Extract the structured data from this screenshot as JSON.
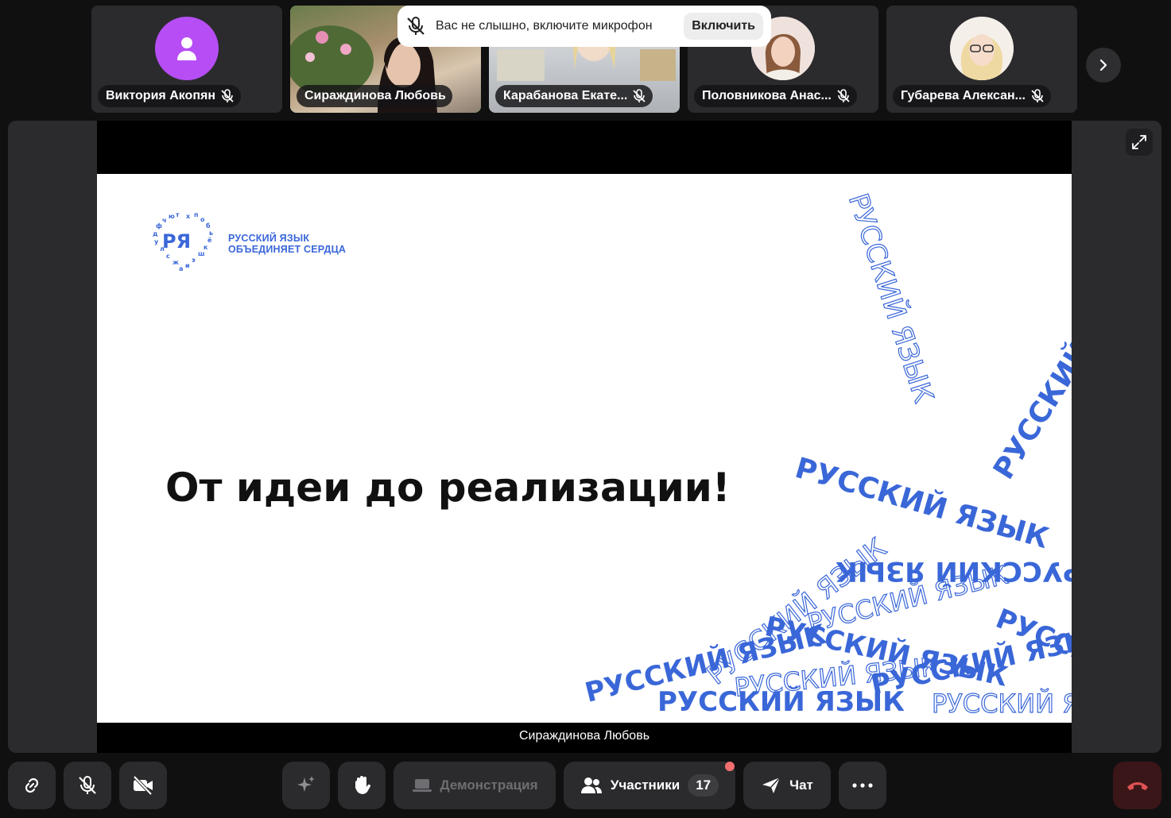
{
  "participants": [
    {
      "name": "Виктория Акопян",
      "muted": true,
      "avatar_color": "#b74ef5",
      "icon": "user-icon"
    },
    {
      "name": "Сираждинова Любовь",
      "muted": false,
      "speaking": true
    },
    {
      "name": "Карабанова Екате...",
      "muted": true
    },
    {
      "name": "Половникова Анас...",
      "muted": true
    },
    {
      "name": "Губарева Алексан...",
      "muted": true
    }
  ],
  "toast": {
    "text": "Вас не слышно, включите микрофон",
    "button": "Включить"
  },
  "slide": {
    "logo_text_line1": "РУССКИЙ ЯЗЫК",
    "logo_text_line2": "ОБЪЕДИНЯЕТ СЕРДЦА",
    "logo_mark": "РЯ",
    "title": "От идеи до реализации!",
    "decor_word": "РУССКИЙ ЯЗЫК",
    "accent_color": "#3a67d8"
  },
  "presenter_label": "Сираждинова Любовь",
  "toolbar": {
    "demo_label": "Демонстрация",
    "participants_label": "Участники",
    "participants_count": "17",
    "chat_label": "Чат"
  },
  "colors": {
    "active_border": "#3ee06a",
    "end_call": "#e05252",
    "notification_dot": "#f26e6e"
  }
}
